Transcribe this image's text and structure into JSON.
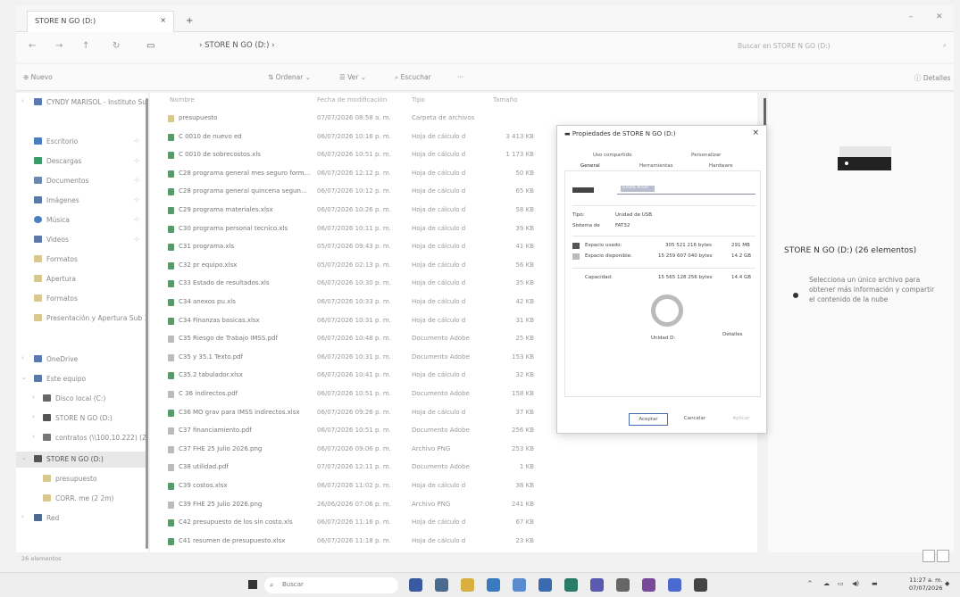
{
  "window": {
    "tab_title": "STORE N GO (D:)",
    "tab_close": "×",
    "new_tab": "+",
    "minimize": "–",
    "close": "✕"
  },
  "address": {
    "back": "←",
    "forward": "→",
    "up": "↑",
    "refresh": "↻",
    "breadcrumb": "›  STORE N GO (D:)  ›",
    "search_placeholder": "Buscar en STORE N GO (D:)",
    "search_icon": "search-icon"
  },
  "commands": {
    "new": "Nuevo",
    "sort": "Ordenar",
    "view": "Ver",
    "filter": "Escuchar",
    "more": "···",
    "details": "Detalles"
  },
  "sidebar": {
    "items": [
      {
        "label": "CYNDY MARISOL - Instituto Su",
        "icon": "cloud-icon",
        "expand": "›"
      },
      {
        "label": "Escritorio",
        "icon": "desktop-icon",
        "expand": ""
      },
      {
        "label": "Descargas",
        "icon": "download-icon",
        "expand": ""
      },
      {
        "label": "Documentos",
        "icon": "document-icon",
        "expand": ""
      },
      {
        "label": "Imágenes",
        "icon": "image-icon",
        "expand": ""
      },
      {
        "label": "Música",
        "icon": "music-icon",
        "expand": ""
      },
      {
        "label": "Videos",
        "icon": "video-icon",
        "expand": ""
      },
      {
        "label": "Formatos",
        "icon": "folder-icon",
        "expand": ""
      },
      {
        "label": "Apertura",
        "icon": "folder-icon",
        "expand": ""
      },
      {
        "label": "Formatos",
        "icon": "folder-icon",
        "expand": ""
      },
      {
        "label": "Presentación y Apertura Sub 1",
        "icon": "folder-icon",
        "expand": ""
      },
      {
        "label": "OneDrive",
        "icon": "cloud-icon",
        "expand": "›"
      },
      {
        "label": "Este equipo",
        "icon": "computer-icon",
        "expand": "⌄"
      },
      {
        "label": "Disco local (C:)",
        "icon": "drive-icon",
        "expand": "›"
      },
      {
        "label": "STORE N GO (D:)",
        "icon": "usb-drive-icon",
        "expand": "›"
      },
      {
        "label": "contratos (\\\\100.10.222) (Z:)",
        "icon": "network-drive-icon",
        "expand": "›"
      },
      {
        "label": "STORE N GO (D:)",
        "icon": "usb-drive-icon",
        "expand": "⌄"
      },
      {
        "label": "presupuesto",
        "icon": "folder-icon",
        "expand": ""
      },
      {
        "label": "CORR. me (2 2m)",
        "icon": "folder-icon",
        "expand": ""
      },
      {
        "label": "Red",
        "icon": "network-icon",
        "expand": "›"
      }
    ],
    "pin": "⊹"
  },
  "file_list": {
    "headers": [
      "Nombre",
      "Fecha de modificación",
      "Tipo",
      "Tamaño"
    ],
    "rows": [
      {
        "name": "presupuesto",
        "date": "07/07/2026 08:58 a. m.",
        "type": "Carpeta de archivos",
        "size": ""
      },
      {
        "name": "C 0010 de nuevo ed",
        "date": "06/07/2026 10:16 p. m.",
        "type": "Hoja de cálculo d",
        "size": "3 413 KB"
      },
      {
        "name": "C 0010 de sobrecostos.xls",
        "date": "06/07/2026 10:51 p. m.",
        "type": "Hoja de cálculo d",
        "size": "1 173 KB"
      },
      {
        "name": "C28 programa general mes seguro form...",
        "date": "06/07/2026 12:12 p. m.",
        "type": "Hoja de cálculo d",
        "size": "50 KB"
      },
      {
        "name": "C28 programa general quincena segun...",
        "date": "06/07/2026 10:12 p. m.",
        "type": "Hoja de cálculo d",
        "size": "65 KB"
      },
      {
        "name": "C29 programa materiales.xlsx",
        "date": "06/07/2026 10:26 p. m.",
        "type": "Hoja de cálculo d",
        "size": "58 KB"
      },
      {
        "name": "C30 programa personal tecnico.xls",
        "date": "06/07/2026 10:11 p. m.",
        "type": "Hoja de cálculo d",
        "size": "39 KB"
      },
      {
        "name": "C31 programa.xls",
        "date": "05/07/2026 09:43 p. m.",
        "type": "Hoja de cálculo d",
        "size": "41 KB"
      },
      {
        "name": "C32 pr equipo.xlsx",
        "date": "05/07/2026 02:13 p. m.",
        "type": "Hoja de cálculo d",
        "size": "56 KB"
      },
      {
        "name": "C33 Estado de resultados.xls",
        "date": "06/07/2026 10:30 p. m.",
        "type": "Hoja de cálculo d",
        "size": "35 KB"
      },
      {
        "name": "C34 anexos pu.xls",
        "date": "06/07/2026 10:33 p. m.",
        "type": "Hoja de cálculo d",
        "size": "42 KB"
      },
      {
        "name": "C34 Finanzas basicas.xlsx",
        "date": "06/07/2026 10:31 p. m.",
        "type": "Hoja de cálculo d",
        "size": "31 KB"
      },
      {
        "name": "C35 Riesgo de Trabajo IMSS.pdf",
        "date": "06/07/2026 10:48 p. m.",
        "type": "Documento Adobe",
        "size": "25 KB"
      },
      {
        "name": "C35 y 35.1 Texto.pdf",
        "date": "06/07/2026 10:31 p. m.",
        "type": "Documento Adobe",
        "size": "153 KB"
      },
      {
        "name": "C35.2 tabulador.xlsx",
        "date": "06/07/2026 10:41 p. m.",
        "type": "Hoja de cálculo d",
        "size": "32 KB"
      },
      {
        "name": "C 36 indirectos.pdf",
        "date": "06/07/2026 10:51 p. m.",
        "type": "Documento Adobe",
        "size": "158 KB"
      },
      {
        "name": "C36 MO grav para IMSS indirectos.xlsx",
        "date": "06/07/2026 09:26 p. m.",
        "type": "Hoja de cálculo d",
        "size": "37 KB"
      },
      {
        "name": "C37 financiamiento.pdf",
        "date": "06/07/2026 10:51 p. m.",
        "type": "Documento Adobe",
        "size": "256 KB"
      },
      {
        "name": "C37 FHE 25 Julio 2026.png",
        "date": "06/07/2026 09:06 p. m.",
        "type": "Archivo PNG",
        "size": "253 KB"
      },
      {
        "name": "C38 utilidad.pdf",
        "date": "07/07/2026 12:11 p. m.",
        "type": "Documento Adobe",
        "size": "1 KB"
      },
      {
        "name": "C39 costos.xlsx",
        "date": "06/07/2026 11:02 p. m.",
        "type": "Hoja de cálculo d",
        "size": "38 KB"
      },
      {
        "name": "C39 FHE 25 Julio 2026.png",
        "date": "26/06/2026 07:06 p. m.",
        "type": "Archivo PNG",
        "size": "241 KB"
      },
      {
        "name": "C42 presupuesto de los sin costo.xls",
        "date": "06/07/2026 11:16 p. m.",
        "type": "Hoja de cálculo d",
        "size": "67 KB"
      },
      {
        "name": "C41 resumen de presupuesto.xlsx",
        "date": "06/07/2026 11:18 p. m.",
        "type": "Hoja de cálculo d",
        "size": "23 KB"
      }
    ]
  },
  "details_pane": {
    "title": "STORE N GO (D:) (26 elementos)",
    "description": "Selecciona un único archivo para obtener más información y compartir el contenido de la nube"
  },
  "dialog": {
    "title": "Propiedades de STORE N GO (D:)",
    "close": "×",
    "tabs_top": [
      "Uso compartido",
      "Personalizar"
    ],
    "tabs_bottom": [
      "General",
      "Herramientas",
      "Hardware"
    ],
    "name_value": "STORE N GO",
    "type_label": "Tipo:",
    "type_value": "Unidad de USB",
    "fs_label": "Sistema de",
    "fs_value": "FAT32",
    "used_label": "Espacio usado:",
    "used_bytes": "305 521 216 bytes",
    "used_short": "291 MB",
    "free_label": "Espacio disponible:",
    "free_bytes": "15 259 607 040 bytes",
    "free_short": "14.2 GB",
    "cap_label": "Capacidad:",
    "cap_bytes": "15 565 128 256 bytes",
    "cap_short": "14.4 GB",
    "drive_label": "Unidad D:",
    "cleanup": "Detalles",
    "used_fraction": 0.02,
    "used_color": "#555555",
    "free_color": "#bbbbbb",
    "ok": "Aceptar",
    "cancel": "Cancelar",
    "apply": "Aplicar"
  },
  "status": {
    "count": "26 elementos"
  },
  "taskbar": {
    "search_placeholder": "Buscar",
    "start_icon": "windows-start-icon",
    "icons": [
      "task-view-icon",
      "widgets-icon",
      "file-explorer-icon",
      "chrome-icon",
      "photos-icon",
      "store-icon",
      "edge-icon",
      "teams-icon",
      "settings-icon",
      "app-icon",
      "zoom-icon",
      "app-icon"
    ],
    "tray": "^",
    "time": "11:27 a. m.",
    "date": "07/07/2026"
  }
}
